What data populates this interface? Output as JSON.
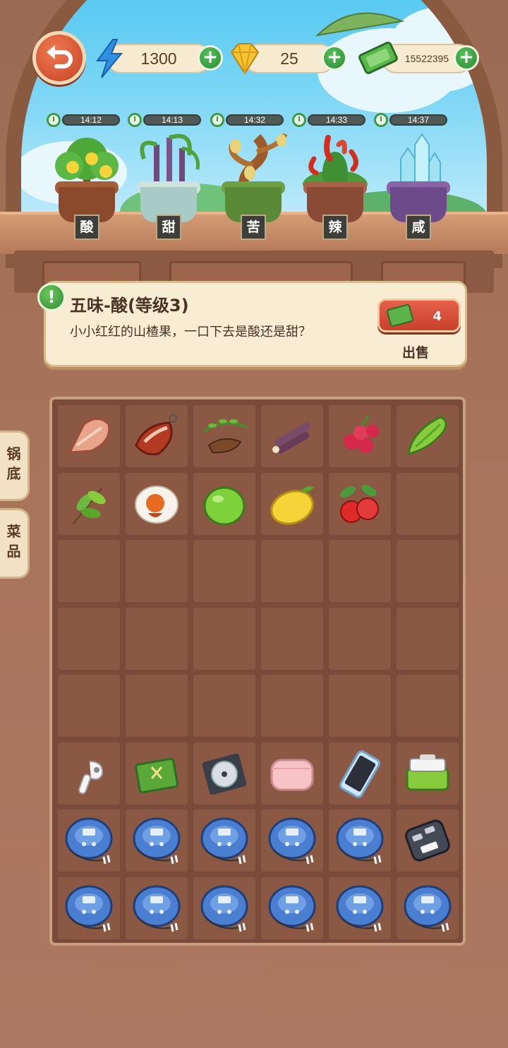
{
  "currencies": {
    "energy": {
      "value": "1300",
      "icon": "lightning-icon"
    },
    "gems": {
      "value": "25",
      "icon": "gem-icon"
    },
    "cash": {
      "value": "15522395",
      "icon": "cash-icon"
    }
  },
  "plants": [
    {
      "timer": "14:12",
      "label": "酸",
      "icon": "lemon-tree-icon"
    },
    {
      "timer": "14:13",
      "label": "甜",
      "icon": "sugarcane-plant-icon"
    },
    {
      "timer": "14:32",
      "label": "苦",
      "icon": "bitter-tree-icon"
    },
    {
      "timer": "14:33",
      "label": "辣",
      "icon": "chili-plant-icon"
    },
    {
      "timer": "14:37",
      "label": "咸",
      "icon": "salt-crystal-icon"
    }
  ],
  "info": {
    "title": "五味-酸(等级3)",
    "description": "小小红红的山楂果，一口下去是酸还是甜？",
    "sell_count": "4",
    "sell_label": "出售"
  },
  "side_tabs": [
    {
      "label": "锅底"
    },
    {
      "label": "菜品"
    }
  ],
  "grid": {
    "rows": [
      [
        "ham-icon",
        "cured-meat-icon",
        "tamarind-icon",
        "sugarcane-icon",
        "bayberry-icon",
        "bitter-melon-icon"
      ],
      [
        "tea-leaves-icon",
        "salted-egg-icon",
        "lime-icon",
        "lemon-icon",
        "hawthorn-icon",
        ""
      ],
      [
        "",
        "",
        "",
        "",
        "",
        ""
      ],
      [
        "",
        "",
        "",
        "",
        "",
        ""
      ],
      [
        "",
        "",
        "",
        "",
        "",
        ""
      ],
      [
        "earbud-icon",
        "notebook-icon",
        "cd-icon",
        "pink-pouch-icon",
        "smartphone-icon",
        "lunchbox-icon"
      ],
      [
        "cd-player-icon",
        "cd-player-icon",
        "cd-player-icon",
        "cd-player-icon",
        "cd-player-icon",
        "car-key-icon"
      ],
      [
        "cd-player-icon",
        "cd-player-icon",
        "cd-player-icon",
        "cd-player-icon",
        "cd-player-icon",
        "cd-player-icon"
      ]
    ]
  },
  "colors": {
    "accent_green": "#3e9a49",
    "sell_red": "#d44a33",
    "panel_cream": "#f8ecd3"
  }
}
